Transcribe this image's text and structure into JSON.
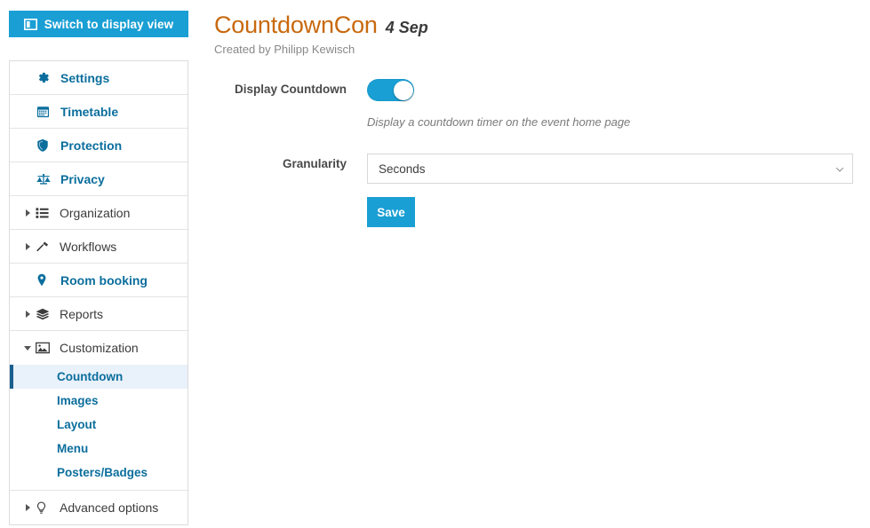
{
  "header": {
    "display_view_button": "Switch to display view",
    "display_view_icon": "columns-display-icon",
    "event_title": "CountdownCon",
    "event_date": "4 Sep",
    "created_by": "Created by Philipp Kewisch"
  },
  "colors": {
    "accent_blue": "#1a9fd4",
    "link_blue": "#0b6e9d",
    "title_orange": "#c8690f",
    "active_bg": "#e9f1fa",
    "active_bar": "#1a5f8f"
  },
  "sidebar": {
    "items": [
      {
        "label": "Settings",
        "icon": "gear-icon",
        "type": "link"
      },
      {
        "label": "Timetable",
        "icon": "calendar-icon",
        "type": "link"
      },
      {
        "label": "Protection",
        "icon": "shield-icon",
        "type": "link"
      },
      {
        "label": "Privacy",
        "icon": "scales-icon",
        "type": "link"
      },
      {
        "label": "Organization",
        "icon": "list-icon",
        "type": "group",
        "expanded": false
      },
      {
        "label": "Workflows",
        "icon": "gavel-icon",
        "type": "group",
        "expanded": false
      },
      {
        "label": "Room booking",
        "icon": "pin-icon",
        "type": "link"
      },
      {
        "label": "Reports",
        "icon": "layers-icon",
        "type": "group",
        "expanded": false
      },
      {
        "label": "Customization",
        "icon": "image-icon",
        "type": "group",
        "expanded": true
      }
    ],
    "customization_children": [
      {
        "label": "Countdown",
        "active": true
      },
      {
        "label": "Images",
        "active": false
      },
      {
        "label": "Layout",
        "active": false
      },
      {
        "label": "Menu",
        "active": false
      },
      {
        "label": "Posters/Badges",
        "active": false
      }
    ],
    "advanced": {
      "label": "Advanced options",
      "icon": "lightbulb-icon",
      "expanded": false
    }
  },
  "form": {
    "display_countdown_label": "Display Countdown",
    "display_countdown_on": true,
    "display_countdown_help": "Display a countdown timer on the event home page",
    "granularity_label": "Granularity",
    "granularity_value": "Seconds",
    "granularity_options": [
      "Seconds"
    ],
    "save_label": "Save"
  }
}
